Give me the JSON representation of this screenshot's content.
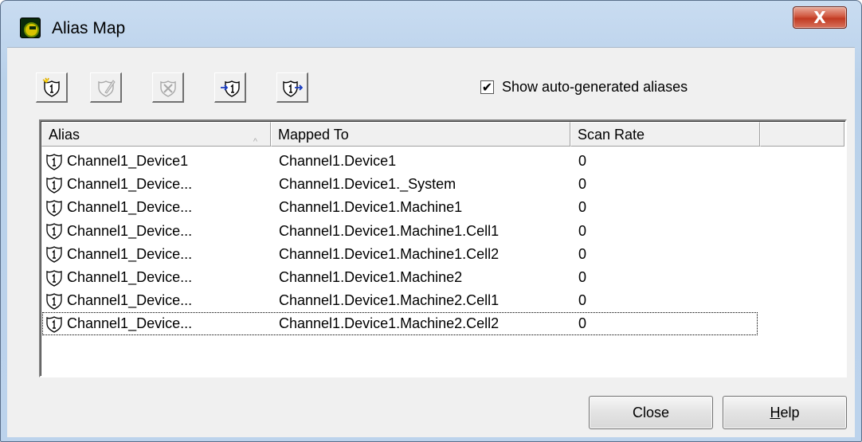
{
  "window": {
    "title": "Alias Map",
    "close_glyph": "X"
  },
  "toolbar": {
    "buttons": [
      {
        "name": "new-alias",
        "icon": "new-alias-icon",
        "enabled": true
      },
      {
        "name": "edit-alias",
        "icon": "edit-alias-icon",
        "enabled": false
      },
      {
        "name": "delete-alias",
        "icon": "delete-alias-icon",
        "enabled": false
      },
      {
        "name": "import-alias",
        "icon": "import-alias-icon",
        "enabled": true
      },
      {
        "name": "export-alias",
        "icon": "export-alias-icon",
        "enabled": true
      }
    ]
  },
  "options": {
    "show_auto_generated": {
      "label": "Show auto-generated aliases",
      "checked": true,
      "check_glyph": "✔"
    }
  },
  "table": {
    "columns": [
      "Alias",
      "Mapped To",
      "Scan Rate"
    ],
    "sort_indicator": "^",
    "rows": [
      {
        "alias": "Channel1_Device1",
        "mapped_to": "Channel1.Device1",
        "scan_rate": "0"
      },
      {
        "alias": "Channel1_Device...",
        "mapped_to": "Channel1.Device1._System",
        "scan_rate": "0"
      },
      {
        "alias": "Channel1_Device...",
        "mapped_to": "Channel1.Device1.Machine1",
        "scan_rate": "0"
      },
      {
        "alias": "Channel1_Device...",
        "mapped_to": "Channel1.Device1.Machine1.Cell1",
        "scan_rate": "0"
      },
      {
        "alias": "Channel1_Device...",
        "mapped_to": "Channel1.Device1.Machine1.Cell2",
        "scan_rate": "0"
      },
      {
        "alias": "Channel1_Device...",
        "mapped_to": "Channel1.Device1.Machine2",
        "scan_rate": "0"
      },
      {
        "alias": "Channel1_Device...",
        "mapped_to": "Channel1.Device1.Machine2.Cell1",
        "scan_rate": "0"
      },
      {
        "alias": "Channel1_Device...",
        "mapped_to": "Channel1.Device1.Machine2.Cell2",
        "scan_rate": "0"
      }
    ],
    "focused_row": 7,
    "row_icon": "alias-shield-icon"
  },
  "footer": {
    "close_label": "Close",
    "help_label_accel": "H",
    "help_label_rest": "elp"
  }
}
